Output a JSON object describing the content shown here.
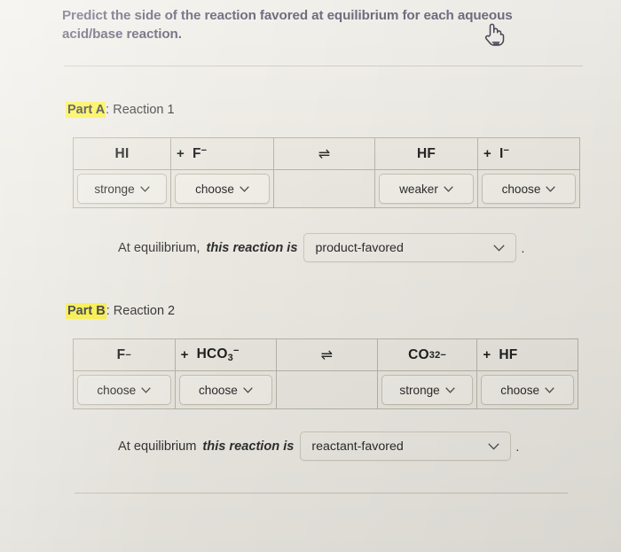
{
  "prompt": "Predict the side of the reaction favored at equilibrium for each aqueous acid/base reaction.",
  "cursor": {
    "icon": "pointing-hand-cursor"
  },
  "parts": [
    {
      "id": "a",
      "label": "Part A",
      "separator": ":",
      "title": "Reaction 1",
      "reaction": {
        "columns": [
          {
            "plus": "",
            "formula_html": "HI",
            "select": "stronge"
          },
          {
            "plus": "+",
            "formula_html": "F<sup>−</sup>",
            "select": "choose"
          },
          {
            "plus": "",
            "formula_html": "⇌",
            "select": null
          },
          {
            "plus": "",
            "formula_html": "HF",
            "select": "weaker"
          },
          {
            "plus": "+",
            "formula_html": "I<sup>−</sup>",
            "select": "choose"
          }
        ]
      },
      "equilibrium": {
        "lead": "At equilibrium,",
        "emphasis": "this reaction is",
        "value": "product-favored",
        "period": "."
      }
    },
    {
      "id": "b",
      "label": "Part B",
      "separator": ":",
      "title": "Reaction 2",
      "reaction": {
        "columns": [
          {
            "plus": "",
            "formula_html": "F<sup>−</sup>",
            "select": "choose"
          },
          {
            "plus": "+",
            "formula_html": "HCO<sub>3</sub><sup>−</sup>",
            "select": "choose"
          },
          {
            "plus": "",
            "formula_html": "⇌",
            "select": null
          },
          {
            "plus": "",
            "formula_html": "CO<sub>3</sub><sup>2−</sup>",
            "select": "stronge"
          },
          {
            "plus": "+",
            "formula_html": "HF",
            "select": "choose"
          }
        ]
      },
      "equilibrium": {
        "lead": "At equilibrium",
        "emphasis": "this reaction is",
        "value": "reactant-favored",
        "period": "."
      }
    }
  ],
  "colors": {
    "page_background": "#eceae3",
    "prompt_text": "#3c3550",
    "highlight": "#fbf13f",
    "table_border": "#b9b4a8",
    "select_background": "#efede6"
  },
  "icons": {
    "caret": "chevron-down-icon",
    "equilibrium_arrow": "equilibrium-arrow-icon"
  }
}
